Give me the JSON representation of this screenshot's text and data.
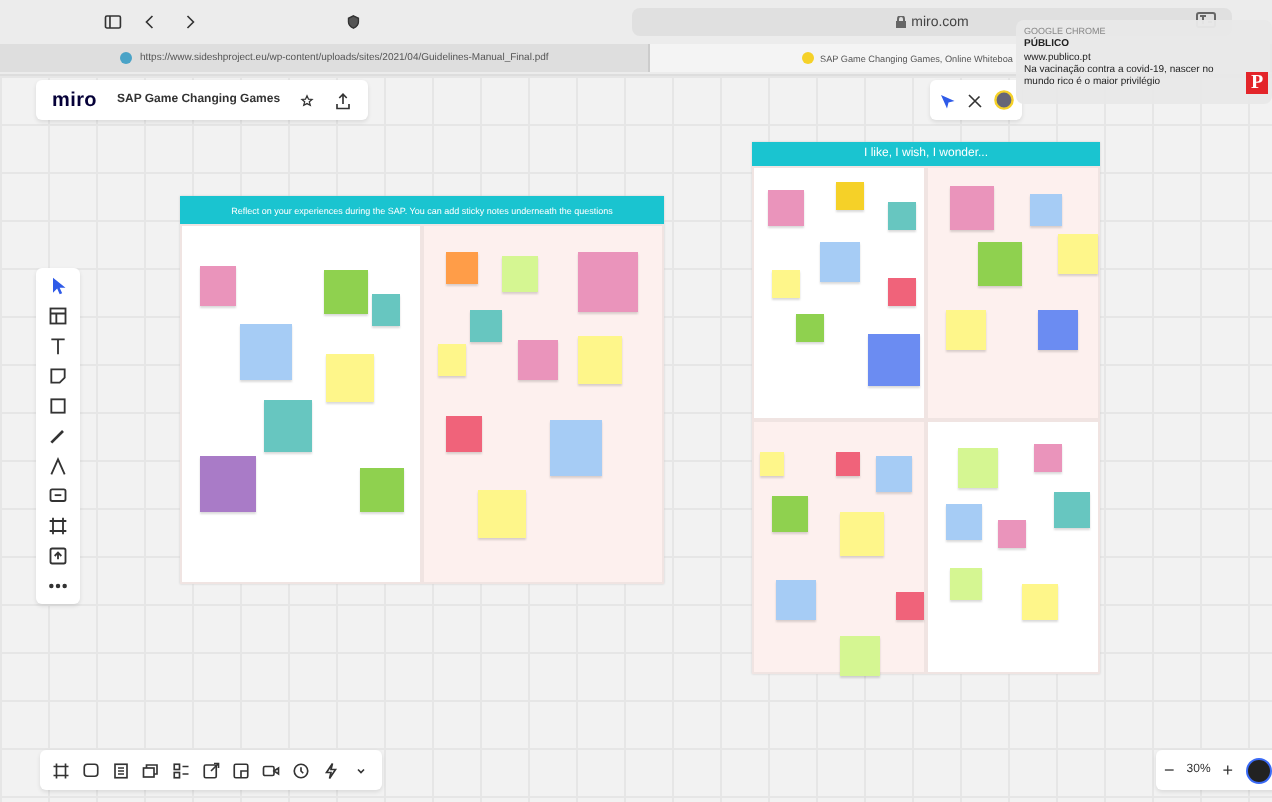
{
  "browser": {
    "address": "miro.com",
    "tabs": [
      {
        "label": "https://www.sideshproject.eu/wp-content/uploads/sites/2021/04/Guidelines-Manual_Final.pdf",
        "selected": false
      },
      {
        "label": "SAP Game Changing Games, Online Whiteboa",
        "selected": true
      }
    ]
  },
  "board_header": {
    "logo": "miro",
    "title": "SAP Game Changing Games"
  },
  "frames": [
    {
      "title": "Reflect on your experiences during the SAP. You can add sticky notes underneath the questions",
      "sections": [
        {
          "shaded": false,
          "notes": [
            {
              "color": "#ea94bb"
            },
            {
              "color": "#8fd14f"
            },
            {
              "color": "#67c6c0"
            },
            {
              "color": "#a6ccf5"
            },
            {
              "color": "#fef68a"
            },
            {
              "color": "#67c6c0"
            },
            {
              "color": "#a97bc7"
            },
            {
              "color": "#8fd14f"
            }
          ]
        },
        {
          "shaded": true,
          "notes": [
            {
              "color": "#ff9d48"
            },
            {
              "color": "#d5f692"
            },
            {
              "color": "#ea94bb"
            },
            {
              "color": "#67c6c0"
            },
            {
              "color": "#fef68a"
            },
            {
              "color": "#ea94bb"
            },
            {
              "color": "#fef68a"
            },
            {
              "color": "#f0637a"
            },
            {
              "color": "#a6ccf5"
            },
            {
              "color": "#fef68a"
            }
          ]
        }
      ]
    },
    {
      "title": "I like, I wish, I wonder...",
      "sections": [
        {
          "shaded": false,
          "notes": [
            {
              "color": "#ea94bb"
            },
            {
              "color": "#f5d128"
            },
            {
              "color": "#67c6c0"
            },
            {
              "color": "#a6ccf5"
            },
            {
              "color": "#fef68a"
            },
            {
              "color": "#f0637a"
            },
            {
              "color": "#8fd14f"
            },
            {
              "color": "#6b8cf2"
            }
          ]
        },
        {
          "shaded": true,
          "notes": [
            {
              "color": "#ea94bb"
            },
            {
              "color": "#a6ccf5"
            },
            {
              "color": "#8fd14f"
            },
            {
              "color": "#fef68a"
            },
            {
              "color": "#fef68a"
            },
            {
              "color": "#6b8cf2"
            }
          ]
        },
        {
          "shaded": true,
          "notes": [
            {
              "color": "#fef68a"
            },
            {
              "color": "#f0637a"
            },
            {
              "color": "#a6ccf5"
            },
            {
              "color": "#8fd14f"
            },
            {
              "color": "#fef68a"
            },
            {
              "color": "#a6ccf5"
            },
            {
              "color": "#f0637a"
            },
            {
              "color": "#d5f692"
            }
          ]
        },
        {
          "shaded": false,
          "notes": [
            {
              "color": "#d5f692"
            },
            {
              "color": "#ea94bb"
            },
            {
              "color": "#a6ccf5"
            },
            {
              "color": "#ea94bb"
            },
            {
              "color": "#67c6c0"
            },
            {
              "color": "#d5f692"
            },
            {
              "color": "#fef68a"
            }
          ]
        }
      ]
    }
  ],
  "zoom": {
    "minus": "−",
    "value": "30%",
    "plus": "+"
  },
  "notification": {
    "app": "GOOGLE CHROME",
    "title": "PÚBLICO",
    "site": "www.publico.pt",
    "message": "Na vacinação contra a covid-19, nascer no mundo rico é o maior privilégio",
    "badge": "P"
  }
}
